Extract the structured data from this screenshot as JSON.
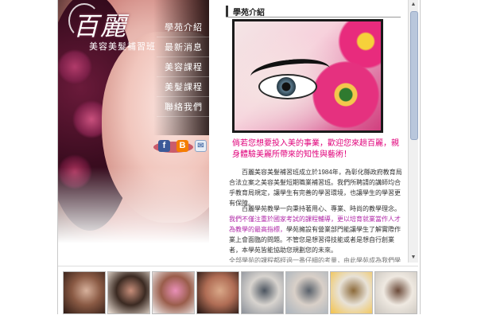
{
  "brand": {
    "logo_text": "百麗",
    "school_name": "美容美髮補習班"
  },
  "nav": {
    "items": [
      {
        "label": "學苑介紹"
      },
      {
        "label": "最新消息"
      },
      {
        "label": "美容課程"
      },
      {
        "label": "美髮課程"
      },
      {
        "label": "聯絡我們"
      }
    ]
  },
  "social": {
    "facebook_glyph": "f",
    "blogger_glyph": "B",
    "mail_glyph": "✉",
    "icons": [
      "facebook-icon",
      "blogger-icon",
      "mail-icon"
    ]
  },
  "main": {
    "section_title": "學苑介紹",
    "tagline": "倘若您想要投入美的事業，歡迎您來趟百麗，親身體驗美麗所帶來的知性與藝術！",
    "paragraph1": "百麗美容美髮補習班成立於1984年，為彰化縣政府教育局合法立案之美容美髮短期職業補習班。我們所聘請的講師均合乎教育局規定，讓學生有完善的學習環境，也讓學生的學習更有保障。",
    "paragraph2_before": "百麗學苑教學一向秉持著用心、專業、時尚的教學理念。",
    "paragraph2_highlight": "我們不僅注重於國家考試的課程輔導，更以培育就業當作人才為教學的最高指標，",
    "paragraph2_after": "學苑擁設有營業部門能讓學生了解實際作業上會面臨的問題。不管您是想習得技能或者是想自行創業者，本學苑皆能協助您規劃您的未來。",
    "cut_line": "全部學苑的課程都經過一番仔細的考量，由此學苑成為我們學生的學習與生活基地"
  },
  "gallery": {
    "items": [
      {
        "name": "gallery-photo-1",
        "colors": [
          "#2d1a14",
          "#d7b19c",
          "#8a5a44"
        ]
      },
      {
        "name": "gallery-photo-2",
        "colors": [
          "#efe3d8",
          "#c78e7a",
          "#3b2a22"
        ]
      },
      {
        "name": "gallery-photo-3",
        "colors": [
          "#f2f2f2",
          "#e98fb7",
          "#9a5d4b"
        ]
      },
      {
        "name": "gallery-photo-4",
        "colors": [
          "#1e1210",
          "#d9a888",
          "#b06d55"
        ]
      },
      {
        "name": "gallery-photo-5",
        "colors": [
          "#8a8f98",
          "#4c5560",
          "#d8d4cf"
        ]
      },
      {
        "name": "gallery-photo-6",
        "colors": [
          "#a9b3bd",
          "#59616b",
          "#d9d0c8"
        ]
      },
      {
        "name": "gallery-photo-7",
        "colors": [
          "#f3c24a",
          "#8c6a3a",
          "#e8e2d7"
        ]
      },
      {
        "name": "gallery-photo-8",
        "colors": [
          "#c9c4bd",
          "#6c4b3a",
          "#efe9e1"
        ]
      }
    ]
  },
  "colors": {
    "accent_pink": "#e0007a",
    "highlight_purple": "#b02aa8"
  }
}
